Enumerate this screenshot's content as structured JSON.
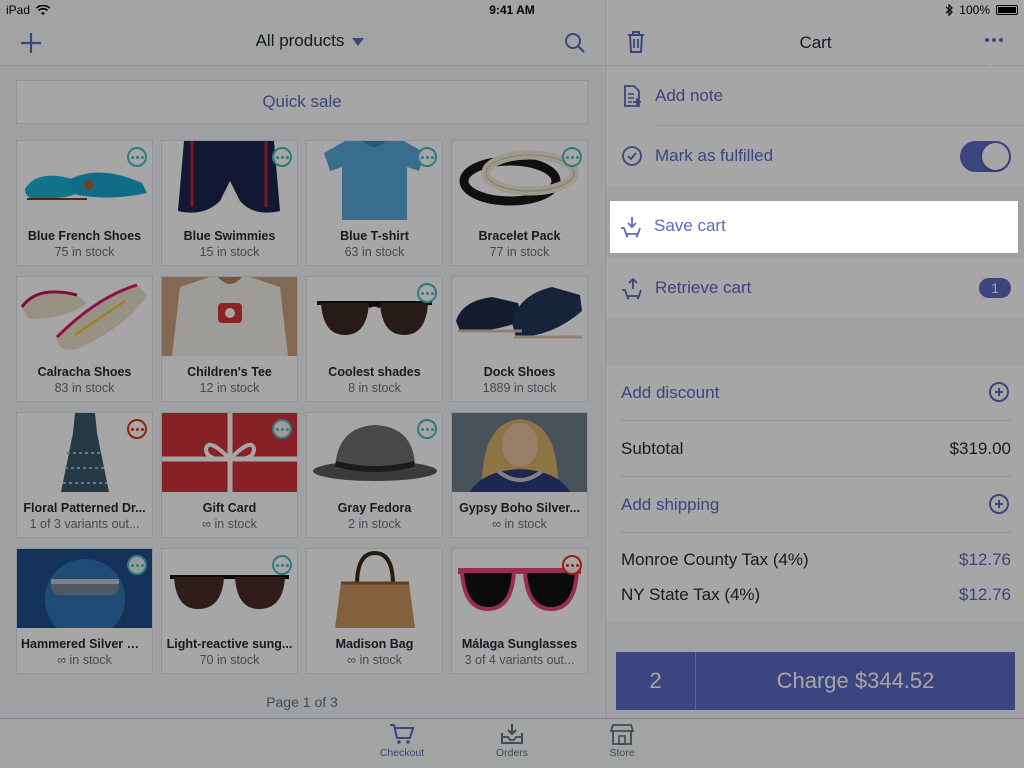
{
  "status_bar": {
    "device": "iPad",
    "time": "9:41 AM",
    "battery": "100%"
  },
  "products": {
    "title": "All products",
    "quick_sale": "Quick sale",
    "items": [
      {
        "name": "Blue French Shoes",
        "stock": "75 in stock",
        "badge": "teal"
      },
      {
        "name": "Blue Swimmies",
        "stock": "15 in stock",
        "badge": "teal"
      },
      {
        "name": "Blue T-shirt",
        "stock": "63 in stock",
        "badge": "teal"
      },
      {
        "name": "Bracelet Pack",
        "stock": "77 in stock",
        "badge": "teal"
      },
      {
        "name": "Calracha Shoes",
        "stock": "83 in stock",
        "badge": "none"
      },
      {
        "name": "Children's Tee",
        "stock": "12 in stock",
        "badge": "none"
      },
      {
        "name": "Coolest shades",
        "stock": "8 in stock",
        "badge": "teal"
      },
      {
        "name": "Dock Shoes",
        "stock": "1889 in stock",
        "badge": "none"
      },
      {
        "name": "Floral Patterned Dr...",
        "stock": "1 of 3 variants out...",
        "badge": "red"
      },
      {
        "name": "Gift Card",
        "stock": "∞ in stock",
        "badge": "teal"
      },
      {
        "name": "Gray Fedora",
        "stock": "2 in stock",
        "badge": "teal"
      },
      {
        "name": "Gypsy Boho Silver...",
        "stock": "∞ in stock",
        "badge": "none"
      },
      {
        "name": "Hammered Silver Ri...",
        "stock": "∞ in stock",
        "badge": "teal"
      },
      {
        "name": "Light-reactive sung...",
        "stock": "70 in stock",
        "badge": "teal"
      },
      {
        "name": "Madison Bag",
        "stock": "∞ in stock",
        "badge": "none"
      },
      {
        "name": "Málaga Sunglasses",
        "stock": "3 of 4 variants out...",
        "badge": "red"
      }
    ],
    "pager": "Page 1 of 3"
  },
  "cart": {
    "title": "Cart",
    "menu": {
      "add_note": "Add note",
      "mark_fulfilled": "Mark as fulfilled",
      "save_cart": "Save cart",
      "retrieve_cart": "Retrieve cart",
      "retrieve_count": "1"
    },
    "add_discount": "Add discount",
    "subtotal_label": "Subtotal",
    "subtotal_value": "$319.00",
    "add_shipping": "Add shipping",
    "taxes": [
      {
        "label": "Monroe County Tax (4%)",
        "value": "$12.76"
      },
      {
        "label": "NY State Tax (4%)",
        "value": "$12.76"
      }
    ],
    "quantity": "2",
    "charge": "Charge $344.52"
  },
  "tabs": [
    {
      "label": "Checkout",
      "icon": "cart-icon"
    },
    {
      "label": "Orders",
      "icon": "orders-tray-icon"
    },
    {
      "label": "Store",
      "icon": "store-icon"
    }
  ],
  "colors": {
    "accent": "#5c6ac4",
    "teal": "#47c1bf",
    "red": "#de3618"
  }
}
